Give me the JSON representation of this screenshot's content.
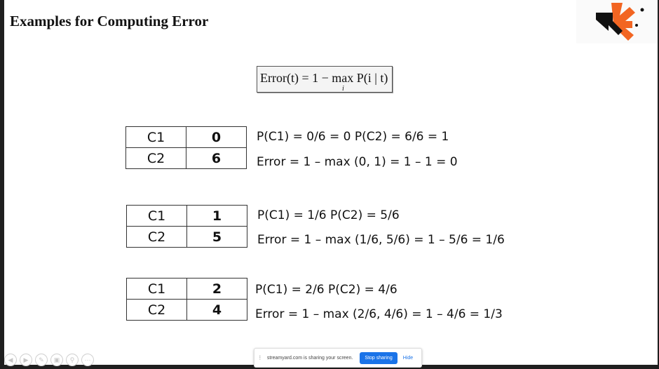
{
  "slide": {
    "title": "Examples for Computing Error",
    "formula": "Error(t) = 1 − max P(i | t)",
    "formula_sub": "i"
  },
  "examples": [
    {
      "rows": [
        [
          "C1",
          "0"
        ],
        [
          "C2",
          "6"
        ]
      ],
      "probabilities": "P(C1) = 0/6 = 0     P(C2) = 6/6 = 1",
      "error": "Error = 1 – max (0, 1) = 1 – 1 = 0"
    },
    {
      "rows": [
        [
          "C1",
          "1"
        ],
        [
          "C2",
          "5"
        ]
      ],
      "probabilities": "P(C1) = 1/6          P(C2) = 5/6",
      "error": "Error = 1 – max (1/6, 5/6) = 1 – 5/6 = 1/6"
    },
    {
      "rows": [
        [
          "C1",
          "2"
        ],
        [
          "C2",
          "4"
        ]
      ],
      "probabilities": "P(C1) = 2/6          P(C2) = 4/6",
      "error": "Error = 1 – max (2/6, 4/6) = 1 – 4/6 = 1/3"
    }
  ],
  "share_bar": {
    "message": "streamyard.com is sharing your screen.",
    "stop_label": "Stop sharing",
    "hide_label": "Hide"
  },
  "icons": {
    "logo": "brand-logo-icon",
    "controls": [
      "prev-icon",
      "next-icon",
      "pen-icon",
      "slides-icon",
      "zoom-icon",
      "more-icon"
    ]
  },
  "colors": {
    "logo_orange": "#f26522",
    "logo_black": "#111111",
    "stop_button": "#1a73e8"
  }
}
